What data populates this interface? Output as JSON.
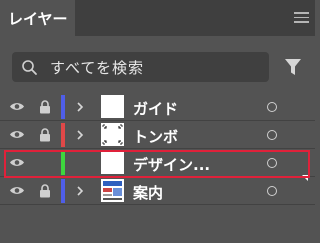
{
  "panel": {
    "tab_label": "レイヤー",
    "menu_icon": "hamburger-menu-icon"
  },
  "search": {
    "placeholder": "すべてを検索",
    "icon": "search-icon"
  },
  "filter": {
    "icon": "filter-funnel-icon"
  },
  "layers": [
    {
      "name": "ガイド",
      "color": "#4f5ee8",
      "visible": true,
      "locked": true,
      "expandable": true,
      "thumbnail": "white"
    },
    {
      "name": "トンボ",
      "color": "#e04848",
      "visible": true,
      "locked": true,
      "expandable": true,
      "thumbnail": "crop-marks"
    },
    {
      "name": "デザイン...",
      "color": "#3ed63e",
      "visible": true,
      "locked": false,
      "expandable": false,
      "thumbnail": "white",
      "highlighted": true
    },
    {
      "name": "案内",
      "color": "#4f5ee8",
      "visible": true,
      "locked": true,
      "expandable": true,
      "thumbnail": "image"
    }
  ],
  "colors": {
    "panel_bg": "#535353",
    "tabbar_bg": "#3f3f3f",
    "search_bg": "#404040",
    "highlight": "#e0213a"
  }
}
